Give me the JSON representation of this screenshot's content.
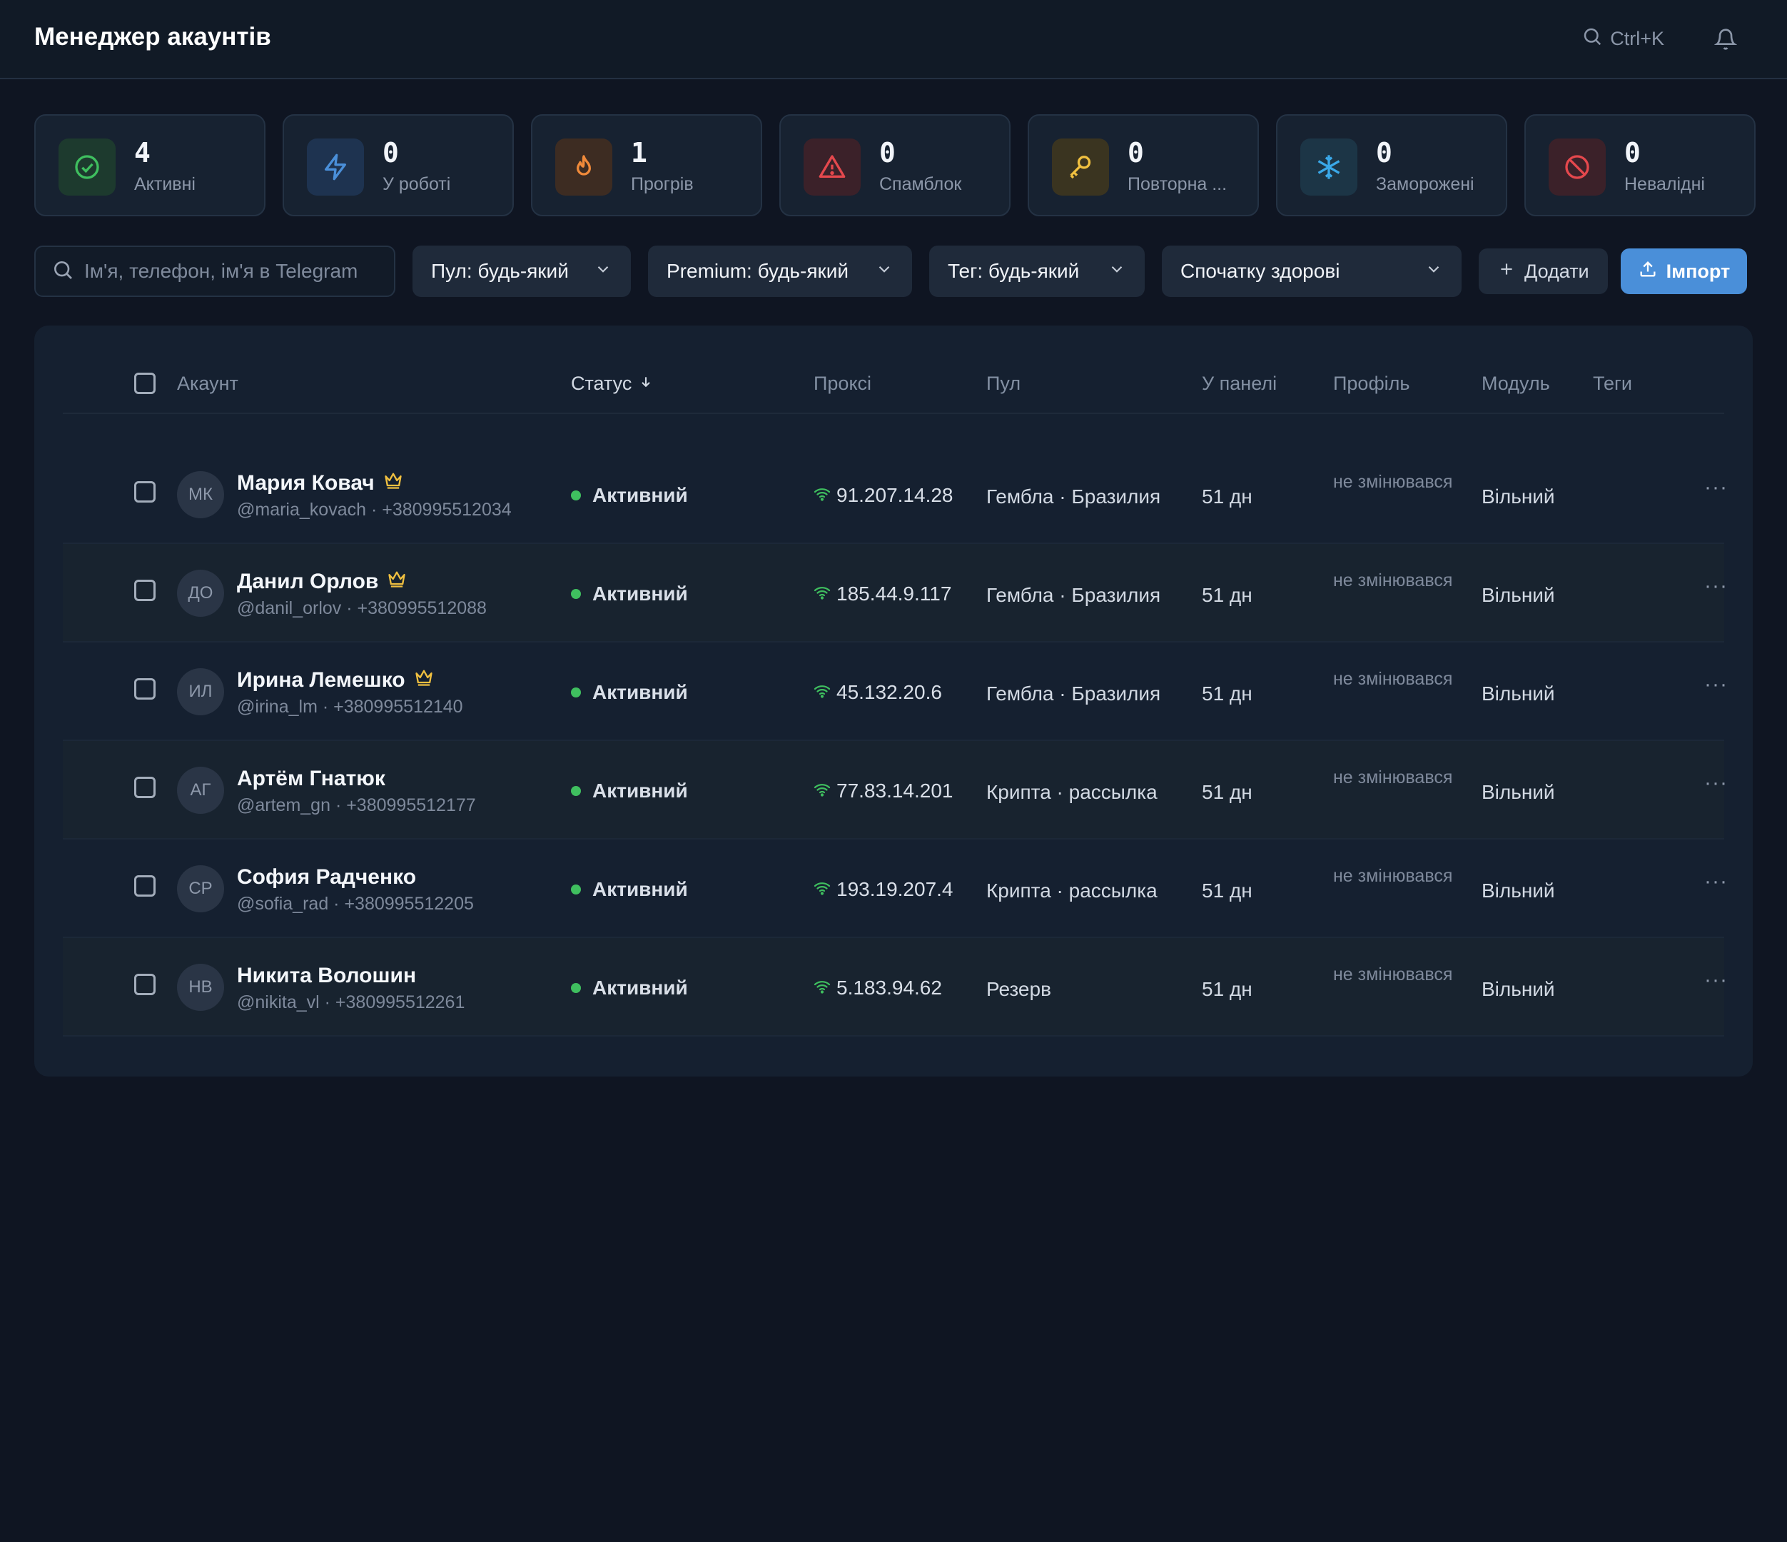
{
  "header": {
    "title": "Менеджер акаунтів",
    "search_shortcut": "Ctrl+K"
  },
  "stats": [
    {
      "value": "4",
      "label": "Активні",
      "icon": "check-circle-icon",
      "color": "#3fbf5f",
      "bg": "#1d3a2e"
    },
    {
      "value": "0",
      "label": "У роботі",
      "icon": "lightning-icon",
      "color": "#4a8fd9",
      "bg": "#1e3350"
    },
    {
      "value": "1",
      "label": "Прогрів",
      "icon": "flame-icon",
      "color": "#f08a3a",
      "bg": "#3d2c22"
    },
    {
      "value": "0",
      "label": "Спамблок",
      "icon": "warning-icon",
      "color": "#e5484d",
      "bg": "#3b2129"
    },
    {
      "value": "0",
      "label": "Повторна ...",
      "icon": "key-icon",
      "color": "#f0c040",
      "bg": "#3a3420"
    },
    {
      "value": "0",
      "label": "Заморожені",
      "icon": "snowflake-icon",
      "color": "#3aa8e8",
      "bg": "#1c3546"
    },
    {
      "value": "0",
      "label": "Невалідні",
      "icon": "blocked-icon",
      "color": "#e5484d",
      "bg": "#3b2129"
    }
  ],
  "toolbar": {
    "search_placeholder": "Ім'я, телефон, ім'я в Telegram",
    "pool_filter": "Пул: будь-який",
    "premium_filter": "Premium: будь-який",
    "tag_filter": "Тег: будь-який",
    "sort": "Спочатку здорові",
    "add_label": "Додати",
    "import_label": "Імпорт"
  },
  "table": {
    "columns": {
      "account": "Акаунт",
      "status": "Статус",
      "proxy": "Проксі",
      "pool": "Пул",
      "panel": "У панелі",
      "profile": "Профіль",
      "module": "Модуль",
      "tags": "Теги"
    },
    "rows": [
      {
        "initials": "МК",
        "name": "Мария Ковач",
        "premium": true,
        "handle": "@maria_kovach · +380995512034",
        "status": "Активний",
        "proxy": "91.207.14.28",
        "pool": "Гембла · Бразилия",
        "age": "51  дн",
        "profile": "не змінювався",
        "module": "Вільний"
      },
      {
        "initials": "ДО",
        "name": "Данил Орлов",
        "premium": true,
        "handle": "@danil_orlov · +380995512088",
        "status": "Активний",
        "proxy": "185.44.9.117",
        "pool": "Гембла · Бразилия",
        "age": "51  дн",
        "profile": "не змінювався",
        "module": "Вільний"
      },
      {
        "initials": "ИЛ",
        "name": "Ирина Лемешко",
        "premium": true,
        "handle": "@irina_lm · +380995512140",
        "status": "Активний",
        "proxy": "45.132.20.6",
        "pool": "Гембла · Бразилия",
        "age": "51  дн",
        "profile": "не змінювався",
        "module": "Вільний"
      },
      {
        "initials": "АГ",
        "name": "Артём Гнатюк",
        "premium": false,
        "handle": "@artem_gn · +380995512177",
        "status": "Активний",
        "proxy": "77.83.14.201",
        "pool": "Крипта · рассылка",
        "age": "51  дн",
        "profile": "не змінювався",
        "module": "Вільний"
      },
      {
        "initials": "СР",
        "name": "София Радченко",
        "premium": false,
        "handle": "@sofia_rad · +380995512205",
        "status": "Активний",
        "proxy": "193.19.207.4",
        "pool": "Крипта · рассылка",
        "age": "51  дн",
        "profile": "не змінювався",
        "module": "Вільний"
      },
      {
        "initials": "НВ",
        "name": "Никита Волошин",
        "premium": false,
        "handle": "@nikita_vl · +380995512261",
        "status": "Активний",
        "proxy": "5.183.94.62",
        "pool": "Резерв",
        "age": "51  дн",
        "profile": "не змінювався",
        "module": "Вільний"
      }
    ]
  }
}
